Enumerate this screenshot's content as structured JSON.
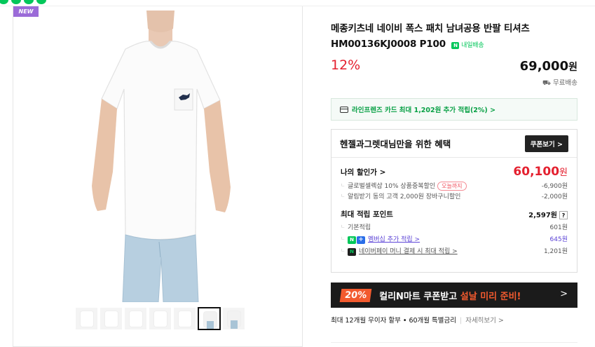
{
  "badge": {
    "new": "NEW"
  },
  "product": {
    "title": "메종키츠네 네이비 폭스 패치 남녀공용 반팔 티셔츠 HM00136KJ0008 P100",
    "delivery_tag": "내일배송",
    "discount": "12%",
    "price": "69,000",
    "currency": "원",
    "shipping": "무료배송"
  },
  "card_promo": "라인프렌즈 카드 최대 1,202원 추가 적립(2%) >",
  "benefit": {
    "title": "헨젤과그렛대님만을 위한 혜택",
    "coupon_button": "쿠폰보기 >",
    "my_price_label": "나의 할인가 >",
    "my_price": "60,100",
    "my_price_unit": "원",
    "discounts": [
      {
        "label": "글로벌셀렉샵 10% 상품중복할인",
        "tag": "오늘까지",
        "value": "-6,900원"
      },
      {
        "label": "알림받기 동의 고객 2,000원 장바구니할인",
        "value": "-2,000원"
      }
    ],
    "points_label": "최대 적립 포인트",
    "points_value": "2,597원",
    "points_help": "?",
    "points": [
      {
        "label": "기본적립",
        "value": "601원"
      },
      {
        "label": "멤버십 추가 적립 >",
        "value": "645원"
      },
      {
        "label": "네이버페이 머니 결제 시 최대 적립 >",
        "value": "1,201원"
      }
    ]
  },
  "banner": {
    "percent": "20%",
    "text_white": "컬리N마트 쿠폰받고 ",
    "text_highlight": "설날 미리 준비!",
    "arrow": ">"
  },
  "installment": {
    "text": "최대 12개월 무이자 할부 • 60개월 특별금리",
    "more": "자세히보기 >"
  },
  "colors": {
    "accent_red": "#e4202f",
    "naver_green": "#03c75a",
    "banner_orange": "#f25a2e"
  }
}
